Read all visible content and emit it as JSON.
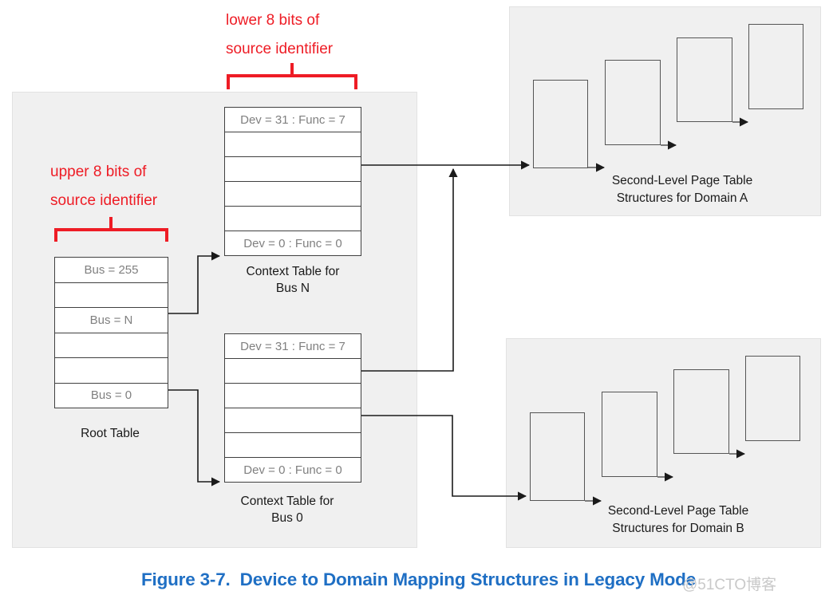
{
  "figure": {
    "caption": "Figure 3-7.  Device to Domain Mapping Structures in Legacy Mode",
    "caption_color": "#1f6fc4",
    "watermark": "@51CTO博客"
  },
  "annotations": {
    "lower_bits": {
      "text": "lower 8 bits of\nsource identifier",
      "color": "#ee1c25"
    },
    "upper_bits": {
      "text": "upper 8 bits of\nsource identifier",
      "color": "#ee1c25"
    }
  },
  "root_table": {
    "caption": "Root Table",
    "rows": [
      {
        "label": "Bus = 255"
      },
      {
        "label": ""
      },
      {
        "label": "Bus = N"
      },
      {
        "label": ""
      },
      {
        "label": ""
      },
      {
        "label": "Bus = 0"
      }
    ]
  },
  "context_table_n": {
    "caption": "Context Table for\nBus N",
    "rows": [
      {
        "label": "Dev = 31 : Func = 7"
      },
      {
        "label": ""
      },
      {
        "label": ""
      },
      {
        "label": ""
      },
      {
        "label": ""
      },
      {
        "label": "Dev = 0 : Func = 0"
      }
    ]
  },
  "context_table_0": {
    "caption": "Context Table for\nBus 0",
    "rows": [
      {
        "label": "Dev = 31 : Func = 7"
      },
      {
        "label": ""
      },
      {
        "label": ""
      },
      {
        "label": ""
      },
      {
        "label": ""
      },
      {
        "label": "Dev = 0 : Func = 0"
      }
    ]
  },
  "domain_a": {
    "caption": "Second-Level Page Table\nStructures for Domain A",
    "page_table_count": 4
  },
  "domain_b": {
    "caption": "Second-Level Page Table\nStructures for Domain B",
    "page_table_count": 4
  },
  "colors": {
    "panel_fill": "#f0f0f0",
    "table_border": "#404040",
    "table_text": "#808080",
    "line": "#1a1a1a",
    "annotation_red": "#ee1c25"
  }
}
